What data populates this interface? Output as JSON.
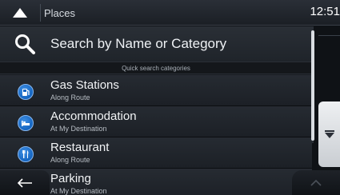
{
  "header": {
    "title": "Places",
    "clock": "12:51"
  },
  "search": {
    "label": "Search by Name or Category"
  },
  "quick_search": {
    "header": "Quick search categories"
  },
  "categories": [
    {
      "label": "Gas Stations",
      "sub": "Along Route",
      "icon": "gas-pump-icon"
    },
    {
      "label": "Accommodation",
      "sub": "At My Destination",
      "icon": "bed-icon"
    },
    {
      "label": "Restaurant",
      "sub": "Along Route",
      "icon": "fork-knife-icon"
    },
    {
      "label": "Parking",
      "sub": "At My Destination",
      "icon": "parking-icon"
    }
  ],
  "colors": {
    "accent": "#1565c0",
    "background": "#171b20"
  }
}
